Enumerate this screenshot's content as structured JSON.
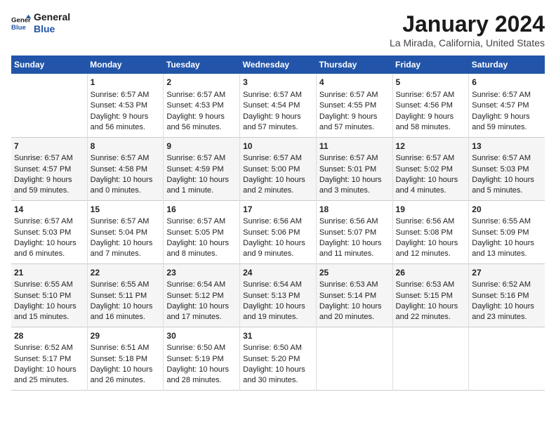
{
  "logo": {
    "line1": "General",
    "line2": "Blue"
  },
  "title": "January 2024",
  "subtitle": "La Mirada, California, United States",
  "header_days": [
    "Sunday",
    "Monday",
    "Tuesday",
    "Wednesday",
    "Thursday",
    "Friday",
    "Saturday"
  ],
  "weeks": [
    {
      "days": [
        {
          "num": "",
          "info": ""
        },
        {
          "num": "1",
          "info": "Sunrise: 6:57 AM\nSunset: 4:53 PM\nDaylight: 9 hours\nand 56 minutes."
        },
        {
          "num": "2",
          "info": "Sunrise: 6:57 AM\nSunset: 4:53 PM\nDaylight: 9 hours\nand 56 minutes."
        },
        {
          "num": "3",
          "info": "Sunrise: 6:57 AM\nSunset: 4:54 PM\nDaylight: 9 hours\nand 57 minutes."
        },
        {
          "num": "4",
          "info": "Sunrise: 6:57 AM\nSunset: 4:55 PM\nDaylight: 9 hours\nand 57 minutes."
        },
        {
          "num": "5",
          "info": "Sunrise: 6:57 AM\nSunset: 4:56 PM\nDaylight: 9 hours\nand 58 minutes."
        },
        {
          "num": "6",
          "info": "Sunrise: 6:57 AM\nSunset: 4:57 PM\nDaylight: 9 hours\nand 59 minutes."
        }
      ]
    },
    {
      "days": [
        {
          "num": "7",
          "info": "Sunrise: 6:57 AM\nSunset: 4:57 PM\nDaylight: 9 hours\nand 59 minutes."
        },
        {
          "num": "8",
          "info": "Sunrise: 6:57 AM\nSunset: 4:58 PM\nDaylight: 10 hours\nand 0 minutes."
        },
        {
          "num": "9",
          "info": "Sunrise: 6:57 AM\nSunset: 4:59 PM\nDaylight: 10 hours\nand 1 minute."
        },
        {
          "num": "10",
          "info": "Sunrise: 6:57 AM\nSunset: 5:00 PM\nDaylight: 10 hours\nand 2 minutes."
        },
        {
          "num": "11",
          "info": "Sunrise: 6:57 AM\nSunset: 5:01 PM\nDaylight: 10 hours\nand 3 minutes."
        },
        {
          "num": "12",
          "info": "Sunrise: 6:57 AM\nSunset: 5:02 PM\nDaylight: 10 hours\nand 4 minutes."
        },
        {
          "num": "13",
          "info": "Sunrise: 6:57 AM\nSunset: 5:03 PM\nDaylight: 10 hours\nand 5 minutes."
        }
      ]
    },
    {
      "days": [
        {
          "num": "14",
          "info": "Sunrise: 6:57 AM\nSunset: 5:03 PM\nDaylight: 10 hours\nand 6 minutes."
        },
        {
          "num": "15",
          "info": "Sunrise: 6:57 AM\nSunset: 5:04 PM\nDaylight: 10 hours\nand 7 minutes."
        },
        {
          "num": "16",
          "info": "Sunrise: 6:57 AM\nSunset: 5:05 PM\nDaylight: 10 hours\nand 8 minutes."
        },
        {
          "num": "17",
          "info": "Sunrise: 6:56 AM\nSunset: 5:06 PM\nDaylight: 10 hours\nand 9 minutes."
        },
        {
          "num": "18",
          "info": "Sunrise: 6:56 AM\nSunset: 5:07 PM\nDaylight: 10 hours\nand 11 minutes."
        },
        {
          "num": "19",
          "info": "Sunrise: 6:56 AM\nSunset: 5:08 PM\nDaylight: 10 hours\nand 12 minutes."
        },
        {
          "num": "20",
          "info": "Sunrise: 6:55 AM\nSunset: 5:09 PM\nDaylight: 10 hours\nand 13 minutes."
        }
      ]
    },
    {
      "days": [
        {
          "num": "21",
          "info": "Sunrise: 6:55 AM\nSunset: 5:10 PM\nDaylight: 10 hours\nand 15 minutes."
        },
        {
          "num": "22",
          "info": "Sunrise: 6:55 AM\nSunset: 5:11 PM\nDaylight: 10 hours\nand 16 minutes."
        },
        {
          "num": "23",
          "info": "Sunrise: 6:54 AM\nSunset: 5:12 PM\nDaylight: 10 hours\nand 17 minutes."
        },
        {
          "num": "24",
          "info": "Sunrise: 6:54 AM\nSunset: 5:13 PM\nDaylight: 10 hours\nand 19 minutes."
        },
        {
          "num": "25",
          "info": "Sunrise: 6:53 AM\nSunset: 5:14 PM\nDaylight: 10 hours\nand 20 minutes."
        },
        {
          "num": "26",
          "info": "Sunrise: 6:53 AM\nSunset: 5:15 PM\nDaylight: 10 hours\nand 22 minutes."
        },
        {
          "num": "27",
          "info": "Sunrise: 6:52 AM\nSunset: 5:16 PM\nDaylight: 10 hours\nand 23 minutes."
        }
      ]
    },
    {
      "days": [
        {
          "num": "28",
          "info": "Sunrise: 6:52 AM\nSunset: 5:17 PM\nDaylight: 10 hours\nand 25 minutes."
        },
        {
          "num": "29",
          "info": "Sunrise: 6:51 AM\nSunset: 5:18 PM\nDaylight: 10 hours\nand 26 minutes."
        },
        {
          "num": "30",
          "info": "Sunrise: 6:50 AM\nSunset: 5:19 PM\nDaylight: 10 hours\nand 28 minutes."
        },
        {
          "num": "31",
          "info": "Sunrise: 6:50 AM\nSunset: 5:20 PM\nDaylight: 10 hours\nand 30 minutes."
        },
        {
          "num": "",
          "info": ""
        },
        {
          "num": "",
          "info": ""
        },
        {
          "num": "",
          "info": ""
        }
      ]
    }
  ]
}
